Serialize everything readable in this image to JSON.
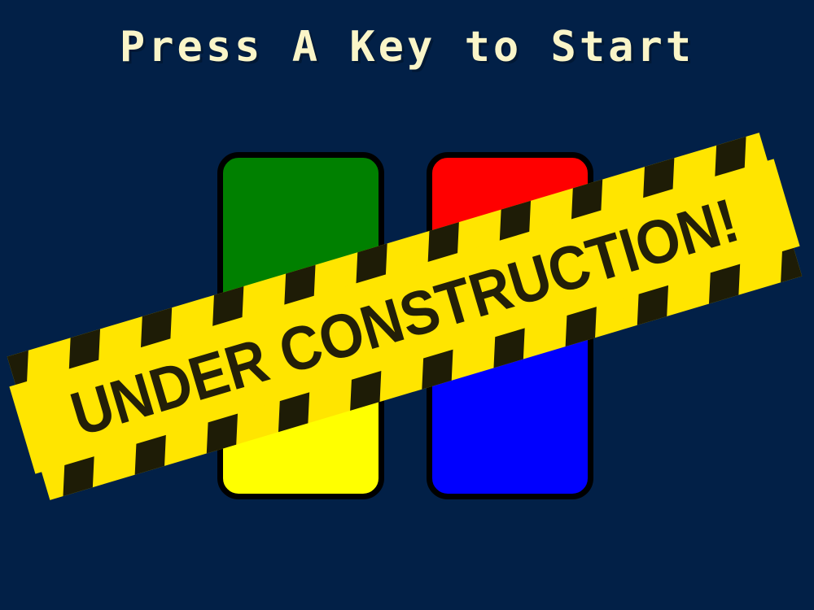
{
  "screen": {
    "prompt_text": "Press A Key to Start",
    "background_color": "#022047",
    "prompt_color": "#faf5c8"
  },
  "tiles": [
    {
      "name": "green",
      "color": "#008000"
    },
    {
      "name": "red",
      "color": "#ff0000"
    },
    {
      "name": "yellow",
      "color": "#ffff00"
    },
    {
      "name": "blue",
      "color": "#0000ff"
    }
  ],
  "banner": {
    "text": "UNDER CONSTRUCTION!",
    "tape_color": "#ffe500",
    "stripe_color": "#1e1c06",
    "text_color": "#231f08"
  }
}
